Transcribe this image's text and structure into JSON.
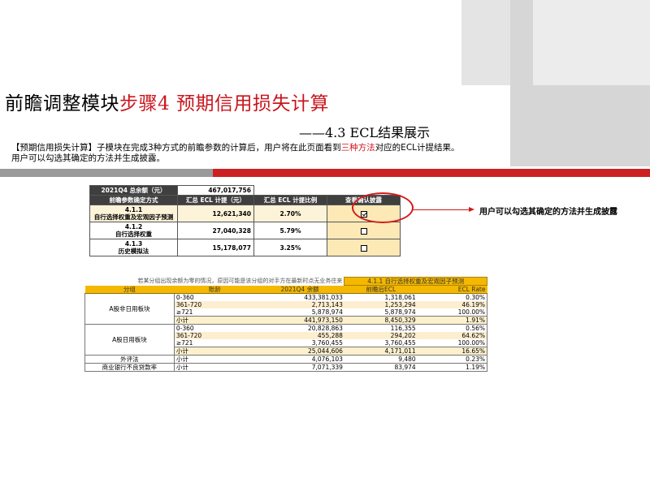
{
  "slide": {
    "title_black": "前瞻调整模块",
    "title_red": "步骤4 预期信用损失计算",
    "subtitle": "——4.3 ECL结果展示",
    "desc_line1_a": "【预期信用损失计算】子模块在完成3种方式的前瞻参数的计算后，用户将在此页面看到",
    "desc_line1_red": "三种方法",
    "desc_line1_b": "对应的ECL计提结果。",
    "desc_line2": "用户可以勾选其确定的方法并生成披露。",
    "callout": "用户可以勾选其确定的方法并生成披露",
    "colors": {
      "red": "#c8161d",
      "dark_header": "#3f3f3f",
      "gold": "#f5b800"
    }
  },
  "ecl_summary": {
    "total_label": "2021Q4 总余额（元）",
    "total_value": "467,017,756",
    "headers": [
      "前瞻参数确定方式",
      "汇总 ECL 计提（元）",
      "汇总 ECL 计提比例",
      "查看确认披露"
    ],
    "rows": [
      {
        "code": "4.1.1",
        "name": "自行选择权重及宏观因子预测",
        "ecl": "12,621,340",
        "ratio": "2.70%",
        "checked": true
      },
      {
        "code": "4.1.2",
        "name": "自行选择权重",
        "ecl": "27,040,328",
        "ratio": "5.79%",
        "checked": false
      },
      {
        "code": "4.1.3",
        "name": "历史模拟法",
        "ecl": "15,178,077",
        "ratio": "3.25%",
        "checked": false
      }
    ]
  },
  "detail": {
    "note": "若某分组出现余额为零的情况，原因可能是该分组的对手方在最新时点无业务往来",
    "band": "4.1.1 自行选择权重及宏观因子预测",
    "headers": [
      "分组",
      "账龄",
      "2021Q4 余额",
      "前瞻后ECL",
      "ECL Rate"
    ],
    "groups": [
      {
        "name": "A股非日用板块",
        "rows": [
          {
            "age": "0-360",
            "balance": "433,381,033",
            "ecl": "1,318,061",
            "rate": "0.30%",
            "hl": false
          },
          {
            "age": "361-720",
            "balance": "2,713,143",
            "ecl": "1,253,294",
            "rate": "46.19%",
            "hl": true
          },
          {
            "age": "≥721",
            "balance": "5,878,974",
            "ecl": "5,878,974",
            "rate": "100.00%",
            "hl": false
          }
        ],
        "subtotal": {
          "age": "小计",
          "balance": "441,973,150",
          "ecl": "8,450,329",
          "rate": "1.91%"
        }
      },
      {
        "name": "A股日用板块",
        "rows": [
          {
            "age": "0-360",
            "balance": "20,828,863",
            "ecl": "116,355",
            "rate": "0.56%",
            "hl": false
          },
          {
            "age": "361-720",
            "balance": "455,288",
            "ecl": "294,202",
            "rate": "64.62%",
            "hl": true
          },
          {
            "age": "≥721",
            "balance": "3,760,455",
            "ecl": "3,760,455",
            "rate": "100.00%",
            "hl": false
          }
        ],
        "subtotal": {
          "age": "小计",
          "balance": "25,044,606",
          "ecl": "4,171,011",
          "rate": "16.65%"
        }
      }
    ],
    "extra": [
      {
        "name": "外评法",
        "age": "小计",
        "balance": "4,076,103",
        "ecl": "9,480",
        "rate": "0.23%"
      },
      {
        "name": "商业银行不良贷款率",
        "age": "小计",
        "balance": "7,071,339",
        "ecl": "83,974",
        "rate": "1.19%"
      }
    ]
  }
}
